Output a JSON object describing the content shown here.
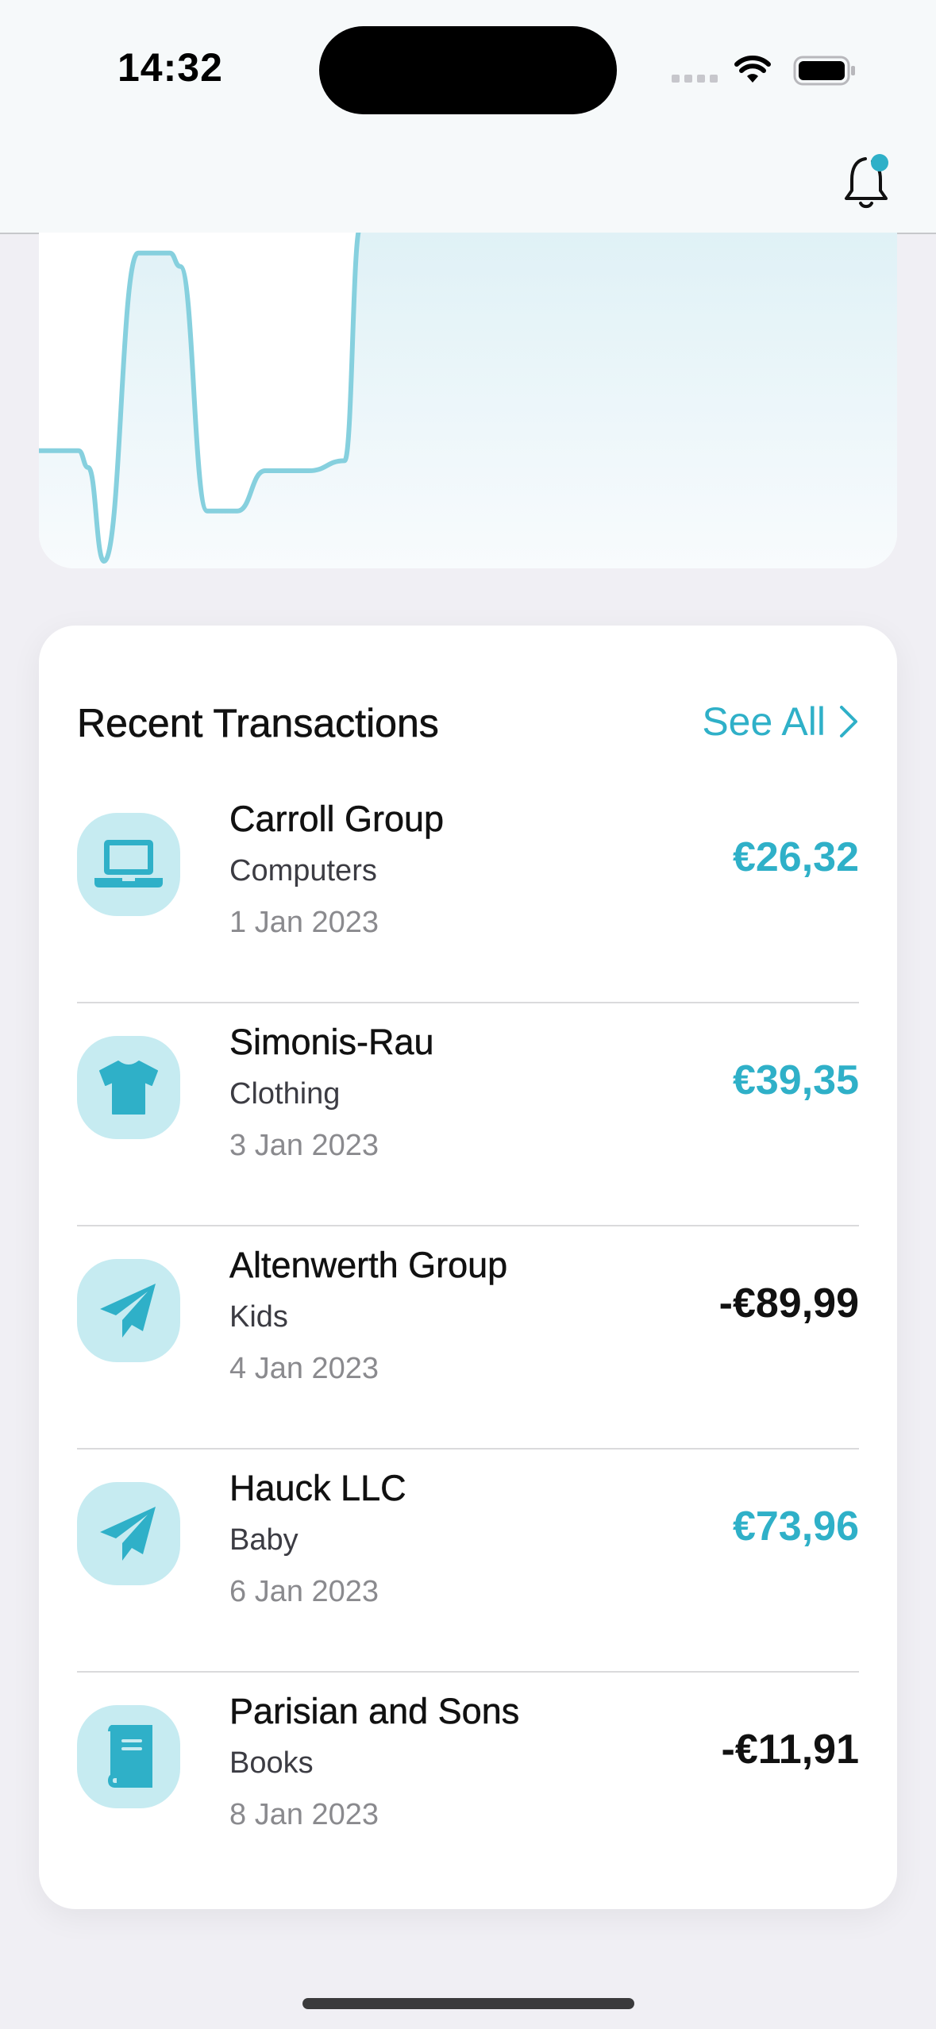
{
  "status_bar": {
    "time": "14:32",
    "icons": [
      "signal-icon",
      "wifi-icon",
      "battery-icon"
    ]
  },
  "nav_bar": {
    "icons": [
      "notification-bell-icon"
    ],
    "has_badge": true
  },
  "chart_data": {
    "type": "area",
    "title": "",
    "xlabel": "",
    "ylabel": "",
    "grid": false,
    "legend": "none",
    "series": [
      {
        "values": [
          0.33,
          0.33,
          0.28,
          0.0,
          0.92,
          0.92,
          0.88,
          0.15,
          0.15,
          0.27,
          0.27,
          0.3,
          1.0,
          1.0
        ]
      }
    ],
    "colors": {
      "line": "#86d0de",
      "fill_top": "#dff1f6",
      "fill_bottom": "#f8fbfd"
    }
  },
  "transactions": {
    "title": "Recent Transactions",
    "see_all": "See All",
    "items": [
      {
        "name": "Carroll Group",
        "category": "Computers",
        "date": "1 Jan 2023",
        "amount": "€26,32",
        "direction": "in",
        "icon": "laptop-icon"
      },
      {
        "name": "Simonis-Rau",
        "category": "Clothing",
        "date": "3 Jan 2023",
        "amount": "€39,35",
        "direction": "in",
        "icon": "tshirt-icon"
      },
      {
        "name": "Altenwerth Group",
        "category": "Kids",
        "date": "4 Jan 2023",
        "amount": "-€89,99",
        "direction": "out",
        "icon": "paper-plane-icon"
      },
      {
        "name": "Hauck LLC",
        "category": "Baby",
        "date": "6 Jan 2023",
        "amount": "€73,96",
        "direction": "in",
        "icon": "paper-plane-icon"
      },
      {
        "name": "Parisian and Sons",
        "category": "Books",
        "date": "8 Jan 2023",
        "amount": "-€11,91",
        "direction": "out",
        "icon": "book-icon"
      }
    ]
  },
  "colors": {
    "accent": "#2fb0c8",
    "icon_bg": "#c6ebf1",
    "page_bg": "#f0eff4"
  }
}
